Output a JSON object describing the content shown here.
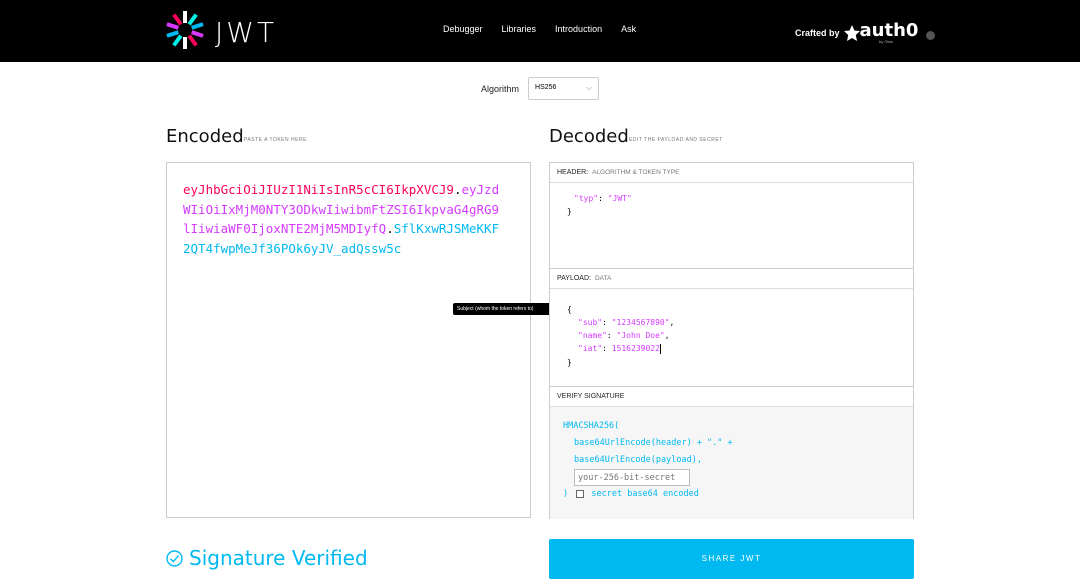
{
  "header": {
    "brand": "JWT",
    "nav": [
      "Debugger",
      "Libraries",
      "Introduction",
      "Ask"
    ],
    "crafted_label": "Crafted by",
    "crafted_brand": "auth0",
    "crafted_sub": "by Okta"
  },
  "algorithm": {
    "label": "Algorithm",
    "value": "HS256"
  },
  "encoded": {
    "title": "Encoded",
    "subtitle": "PASTE A TOKEN HERE",
    "header_part": "eyJhbGciOiJIUzI1NiIsInR5cCI6IkpXVCJ9",
    "dot1": ".",
    "payload_part": "eyJzdWIiOiIxMjM0NTY3ODkwIiwibmFtZSI6IkpvaG4gRG9lIiwiaWF0IjoxNTE2MjM5MDIyfQ",
    "dot2": ".",
    "signature_part": "SflKxwRJSMeKKF2QT4fwpMeJf36POk6yJV_adQssw5c"
  },
  "tooltip": "Subject (whom the token refers to)",
  "decoded": {
    "title": "Decoded",
    "subtitle": "EDIT THE PAYLOAD AND SECRET",
    "header_section": {
      "label": "HEADER:",
      "sublabel": "ALGORITHM & TOKEN TYPE",
      "line1_key": "\"typ\"",
      "line1_sep": ": ",
      "line1_val": "\"JWT\"",
      "line2": "}"
    },
    "payload_section": {
      "label": "PAYLOAD:",
      "sublabel": "DATA",
      "open": "{",
      "sub_key": "\"sub\"",
      "sub_val": "\"1234567890\"",
      "name_key": "\"name\"",
      "name_val": "\"John Doe\"",
      "iat_key": "\"iat\"",
      "iat_val": "1516239022",
      "close": "}"
    },
    "verify_section": {
      "label": "VERIFY SIGNATURE",
      "line1": "HMACSHA256(",
      "line2": "base64UrlEncode(header) + \".\" +",
      "line3": "base64UrlEncode(payload),",
      "secret_placeholder": "your-256-bit-secret",
      "close": ")",
      "checkbox_label": "secret base64 encoded"
    }
  },
  "status": {
    "verified_text": "Signature Verified"
  },
  "share_button": "SHARE JWT",
  "colors": {
    "header_part": "#fb015b",
    "payload_part": "#d63aff",
    "signature_part": "#00b9f1",
    "accent": "#00b9f1"
  }
}
